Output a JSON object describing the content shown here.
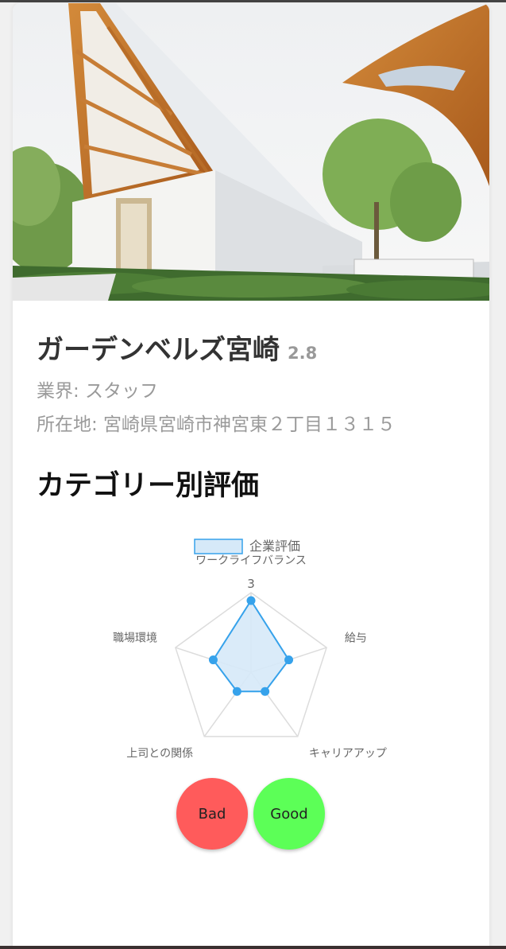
{
  "company": {
    "name": "ガーデンベルズ宮崎",
    "rating": "2.8",
    "industry": "業界: スタッフ",
    "address": "所在地: 宮崎県宮崎市神宮東２丁目１３１５"
  },
  "section": {
    "title": "カテゴリー別評価"
  },
  "chart_data": {
    "type": "radar",
    "legend": "企業評価",
    "categories": [
      "ワークライフバランス",
      "給与",
      "キャリアアップ",
      "上司との関係",
      "職場環境"
    ],
    "values": [
      2.7,
      1.5,
      0.9,
      0.9,
      1.5
    ],
    "rmax": 3,
    "tick_labels": [
      "3"
    ],
    "color": "#36a2eb",
    "fill": "#d6e9f8"
  },
  "actions": {
    "bad_label": "Bad",
    "good_label": "Good"
  },
  "colors": {
    "bad": "#ff5b5b",
    "good": "#5cff57"
  }
}
